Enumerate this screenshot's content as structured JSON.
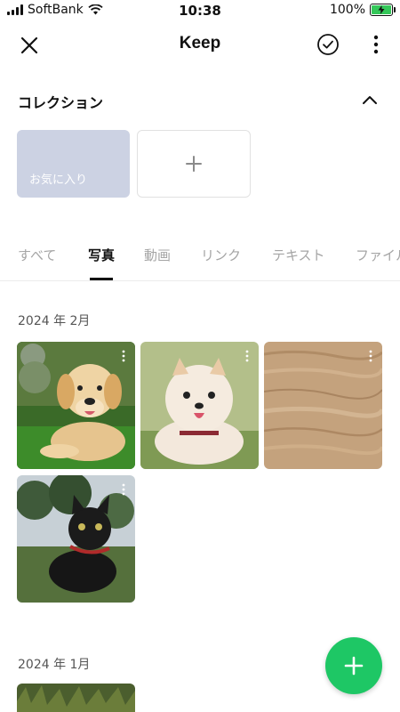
{
  "status_bar": {
    "carrier": "SoftBank",
    "time": "10:38",
    "battery": "100%"
  },
  "header": {
    "title": "Keep"
  },
  "collection": {
    "title": "コレクション",
    "favorites_label": "お気に入り"
  },
  "tabs": [
    {
      "label": "すべて",
      "active": false
    },
    {
      "label": "写真",
      "active": true
    },
    {
      "label": "動画",
      "active": false
    },
    {
      "label": "リンク",
      "active": false
    },
    {
      "label": "テキスト",
      "active": false
    },
    {
      "label": "ファイル",
      "active": false
    }
  ],
  "sections": [
    {
      "label": "2024 年 2月",
      "photos": [
        "golden-retriever-puppy",
        "pomeranian",
        "wood-texture",
        "black-cat"
      ]
    },
    {
      "label": "2024 年 1月",
      "photos": [
        "grass-photo"
      ]
    }
  ],
  "colors": {
    "accent": "#1ec765",
    "favorites_card": "#ccd2e3"
  }
}
